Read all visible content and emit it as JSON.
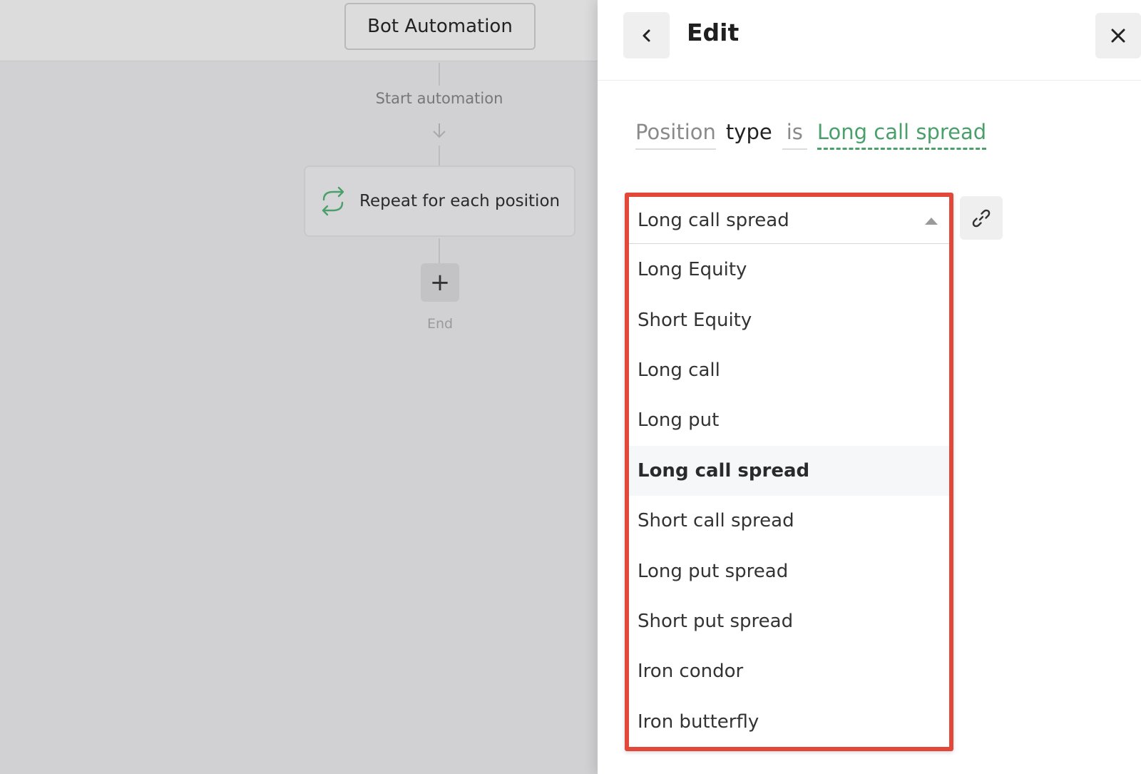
{
  "canvas": {
    "bot_button_label": "Bot Automation",
    "start_label": "Start automation",
    "repeat_card_label": "Repeat for each position",
    "add_step_symbol": "+",
    "end_label": "End"
  },
  "panel": {
    "title": "Edit",
    "condition": {
      "field": "Position",
      "type": "type",
      "operator": "is",
      "value": "Long call spread"
    },
    "dropdown": {
      "selected": "Long call spread",
      "options": [
        "Long Equity",
        "Short Equity",
        "Long call",
        "Long put",
        "Long call spread",
        "Short call spread",
        "Long put spread",
        "Short put spread",
        "Iron condor",
        "Iron butterfly"
      ]
    }
  },
  "colors": {
    "accent_green": "#4a9f6a",
    "highlight_red": "#e2483a"
  },
  "icons": {
    "back": "chevron-left-icon",
    "close": "close-icon",
    "link": "link-icon",
    "repeat": "repeat-icon",
    "arrow": "arrow-down-icon",
    "caret": "caret-up-icon"
  }
}
